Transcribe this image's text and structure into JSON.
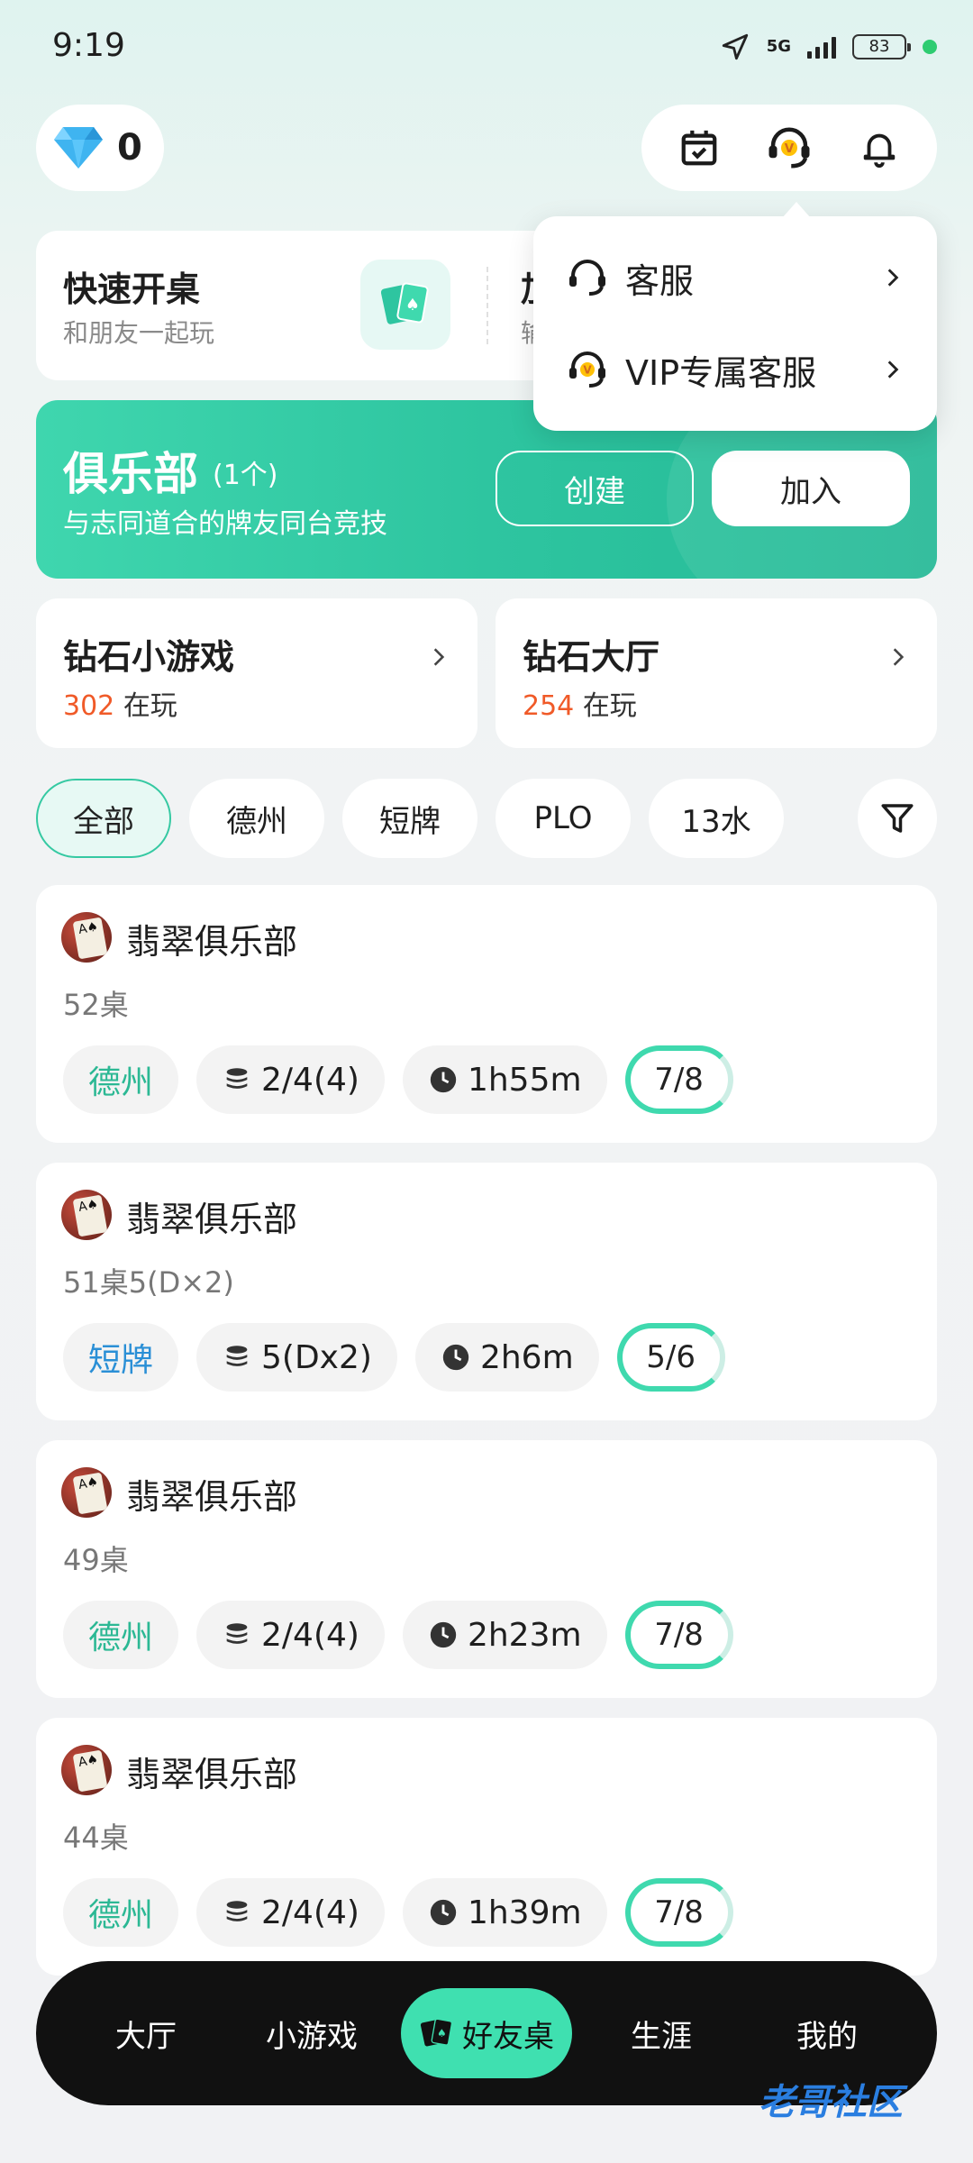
{
  "status_bar": {
    "time": "9:19",
    "network": "5G",
    "battery": "83"
  },
  "wallet": {
    "diamonds": "0"
  },
  "header_icons": [
    "calendar-check-icon",
    "headset-vip-icon",
    "bell-icon"
  ],
  "quick_create": {
    "title": "快速开桌",
    "subtitle": "和朋友一起玩",
    "title2": "加",
    "subtitle2": "输"
  },
  "dropdown": {
    "items": [
      {
        "label": "客服"
      },
      {
        "label": "VIP专属客服"
      }
    ]
  },
  "club": {
    "title": "俱乐部",
    "count": "(1个)",
    "subtitle": "与志同道合的牌友同台竞技",
    "create_label": "创建",
    "join_label": "加入"
  },
  "games": [
    {
      "title": "钻石小游戏",
      "count": "302",
      "suffix": "在玩"
    },
    {
      "title": "钻石大厅",
      "count": "254",
      "suffix": "在玩"
    }
  ],
  "filters": [
    "全部",
    "德州",
    "短牌",
    "PLO",
    "13水"
  ],
  "tables": [
    {
      "club": "翡翠俱乐部",
      "table": "52桌",
      "type": "德州",
      "blinds": "2/4(4)",
      "duration": "1h55m",
      "seats": "7/8"
    },
    {
      "club": "翡翠俱乐部",
      "table": "51桌5(D×2)",
      "type": "短牌",
      "blinds": "5(Dx2)",
      "duration": "2h6m",
      "seats": "5/6"
    },
    {
      "club": "翡翠俱乐部",
      "table": "49桌",
      "type": "德州",
      "blinds": "2/4(4)",
      "duration": "2h23m",
      "seats": "7/8"
    },
    {
      "club": "翡翠俱乐部",
      "table": "44桌",
      "type": "德州",
      "blinds": "2/4(4)",
      "duration": "1h39m",
      "seats": "7/8"
    }
  ],
  "nav": {
    "items": [
      "大厅",
      "小游戏",
      "好友桌",
      "生涯",
      "我的"
    ]
  },
  "watermark": "老哥社区",
  "colors": {
    "accent": "#3fd9ae",
    "orange": "#f05a28",
    "nav_bg": "#111111"
  }
}
